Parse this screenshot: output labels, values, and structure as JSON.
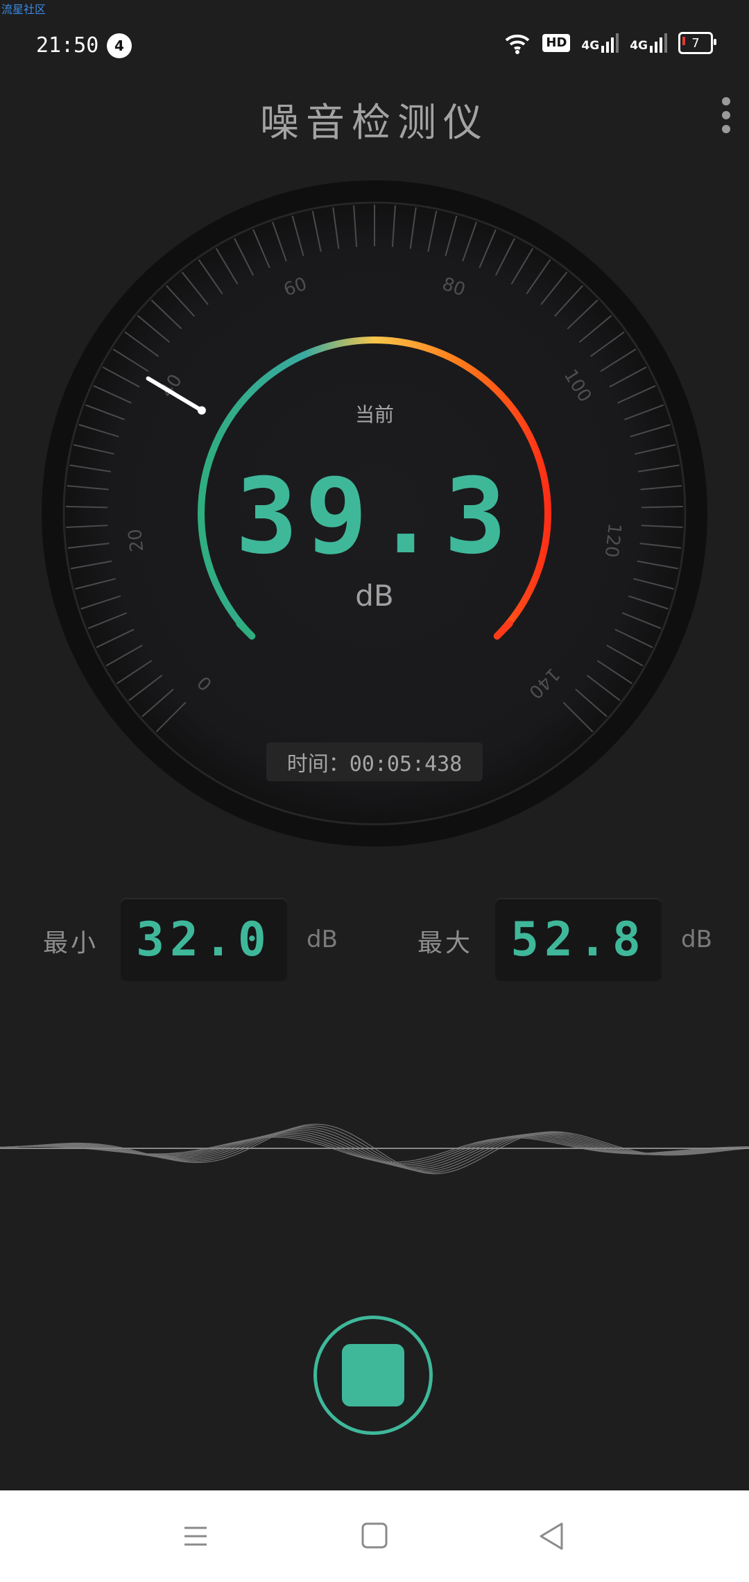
{
  "watermark": "流星社区",
  "status": {
    "time": "21:50",
    "notification_count": "4",
    "hd_label": "HD",
    "net1": "4G",
    "net2": "4G",
    "battery": "7"
  },
  "app": {
    "title": "噪音检测仪"
  },
  "gauge": {
    "current_label": "当前",
    "current_value": "39.3",
    "unit": "dB",
    "ticks": [
      "0",
      "20",
      "40",
      "60",
      "80",
      "100",
      "120",
      "140"
    ],
    "time_label": "时间：00:05:438"
  },
  "stats": {
    "min_label": "最小",
    "min_value": "32.0",
    "max_label": "最大",
    "max_value": "52.8",
    "unit": "dB"
  },
  "colors": {
    "accent": "#3fb89a",
    "arc_start": "#2fae7f",
    "arc_mid": "#f7c64b",
    "arc_end": "#ff2f16"
  }
}
